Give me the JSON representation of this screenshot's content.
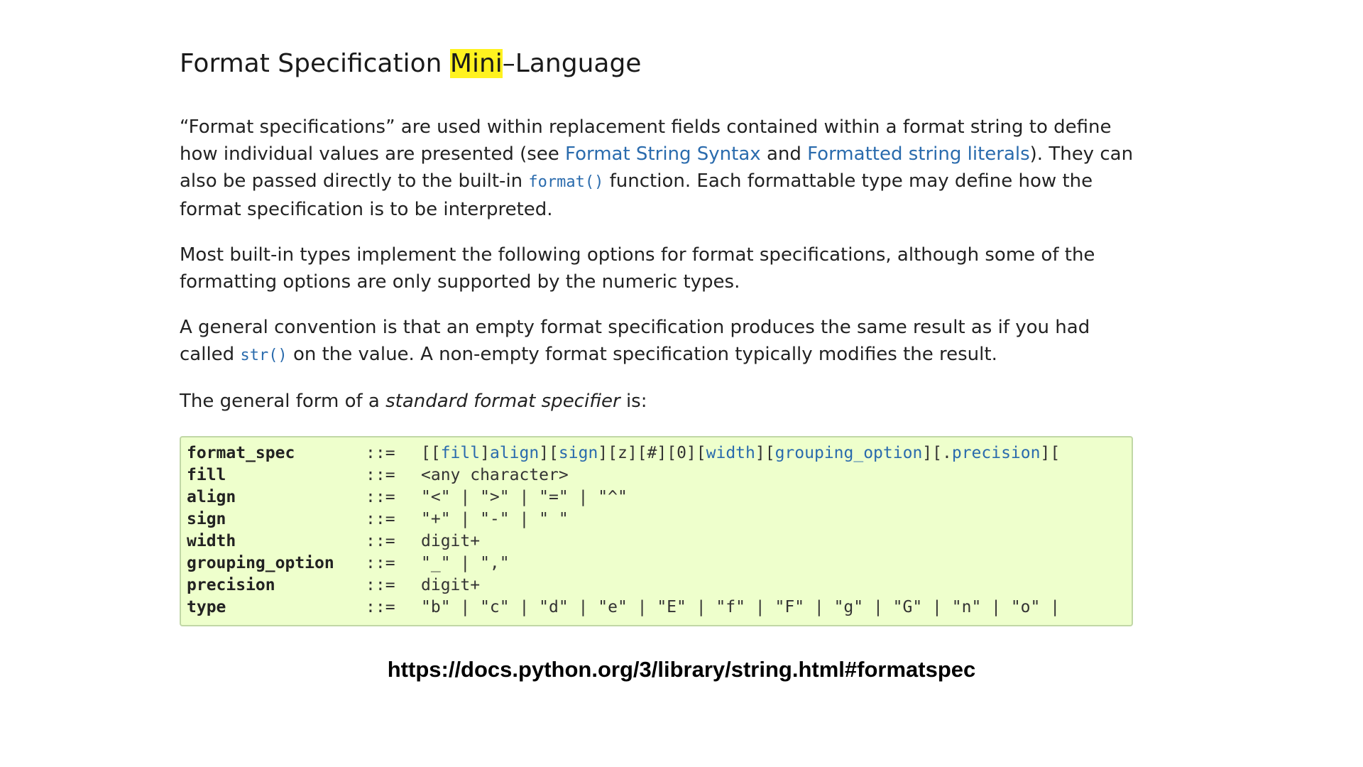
{
  "heading": {
    "before": "Format Specification ",
    "highlight": "Mini",
    "after": "–Language"
  },
  "para1": {
    "t1": "“Format specifications” are used within replacement fields contained within a format string to define how individual values are presented (see ",
    "link1": "Format String Syntax",
    "t2": " and ",
    "link2": "Formatted string literals",
    "t3": "). They can also be passed directly to the built-in ",
    "code": "format()",
    "t4": " function. Each formattable type may define how the format specification is to be interpreted."
  },
  "para2": "Most built-in types implement the following options for format specifications, although some of the formatting options are only supported by the numeric types.",
  "para3": {
    "t1": "A general convention is that an empty format specification produces the same result as if you had called ",
    "code": "str()",
    "t2": " on the value. A non-empty format specification typically modifies the result."
  },
  "para4": {
    "t1": "The general form of a ",
    "em": "standard format specifier",
    "t2": " is:"
  },
  "grammar": {
    "op": "::=",
    "rows": [
      {
        "name": "format_spec",
        "parts": [
          {
            "t": "[[",
            "link": false
          },
          {
            "t": "fill",
            "link": true
          },
          {
            "t": "]",
            "link": false
          },
          {
            "t": "align",
            "link": true
          },
          {
            "t": "][",
            "link": false
          },
          {
            "t": "sign",
            "link": true
          },
          {
            "t": "][z][#][0][",
            "link": false
          },
          {
            "t": "width",
            "link": true
          },
          {
            "t": "][",
            "link": false
          },
          {
            "t": "grouping_option",
            "link": true
          },
          {
            "t": "][.",
            "link": false
          },
          {
            "t": "precision",
            "link": true
          },
          {
            "t": "][",
            "link": false
          }
        ]
      },
      {
        "name": "fill",
        "parts": [
          {
            "t": "<any character>",
            "link": false
          }
        ]
      },
      {
        "name": "align",
        "parts": [
          {
            "t": "\"<\" | \">\" | \"=\" | \"^\"",
            "link": false
          }
        ]
      },
      {
        "name": "sign",
        "parts": [
          {
            "t": "\"+\" | \"-\" | \" \"",
            "link": false
          }
        ]
      },
      {
        "name": "width",
        "parts": [
          {
            "t": "digit+",
            "link": false
          }
        ]
      },
      {
        "name": "grouping_option",
        "parts": [
          {
            "t": "\"_\" | \",\"",
            "link": false
          }
        ]
      },
      {
        "name": "precision",
        "parts": [
          {
            "t": "digit+",
            "link": false
          }
        ]
      },
      {
        "name": "type",
        "parts": [
          {
            "t": "\"b\" | \"c\" | \"d\" | \"e\" | \"E\" | \"f\" | \"F\" | \"g\" | \"G\" | \"n\" | \"o\" |",
            "link": false
          }
        ]
      }
    ]
  },
  "url": "https://docs.python.org/3/library/string.html#formatspec",
  "colors": {
    "link": "#2a6bad",
    "highlight": "#fff21f",
    "code_block_bg": "#eeffcc",
    "code_block_border": "#c1d7a6"
  }
}
